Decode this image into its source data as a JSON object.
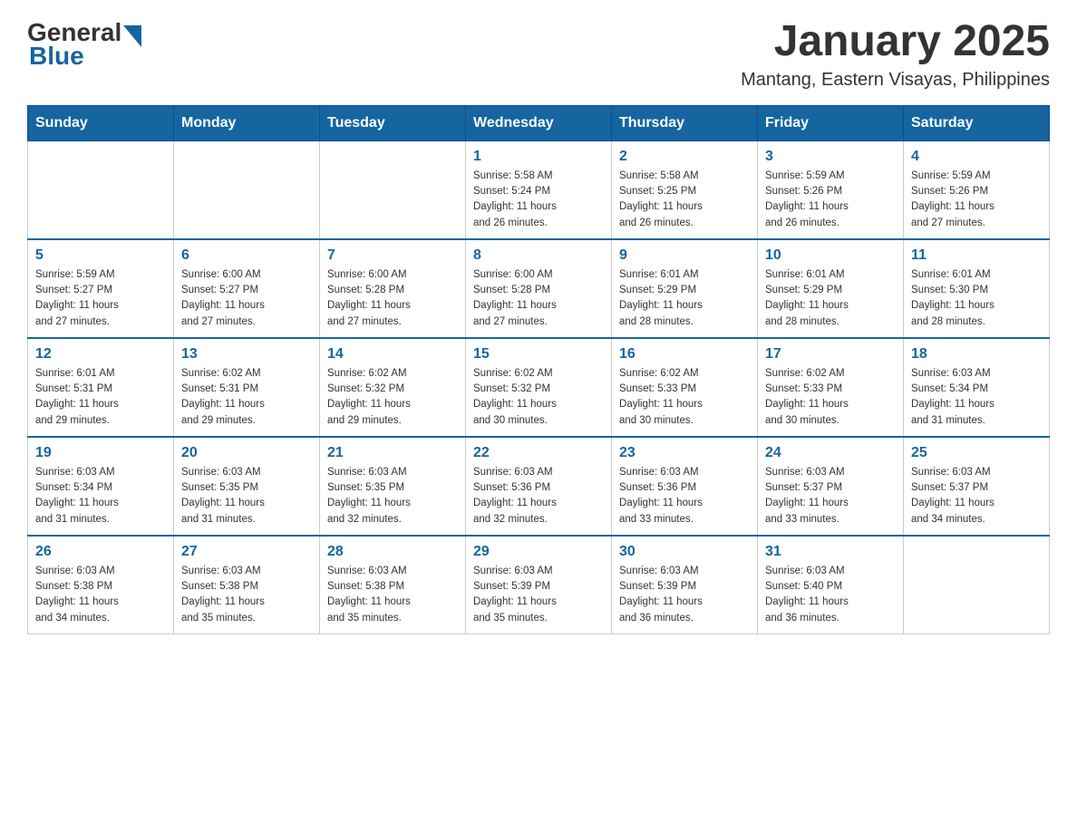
{
  "header": {
    "logo": {
      "general": "General",
      "blue": "Blue"
    },
    "title": "January 2025",
    "subtitle": "Mantang, Eastern Visayas, Philippines"
  },
  "calendar": {
    "days_of_week": [
      "Sunday",
      "Monday",
      "Tuesday",
      "Wednesday",
      "Thursday",
      "Friday",
      "Saturday"
    ],
    "weeks": [
      [
        {
          "day": "",
          "info": ""
        },
        {
          "day": "",
          "info": ""
        },
        {
          "day": "",
          "info": ""
        },
        {
          "day": "1",
          "info": "Sunrise: 5:58 AM\nSunset: 5:24 PM\nDaylight: 11 hours\nand 26 minutes."
        },
        {
          "day": "2",
          "info": "Sunrise: 5:58 AM\nSunset: 5:25 PM\nDaylight: 11 hours\nand 26 minutes."
        },
        {
          "day": "3",
          "info": "Sunrise: 5:59 AM\nSunset: 5:26 PM\nDaylight: 11 hours\nand 26 minutes."
        },
        {
          "day": "4",
          "info": "Sunrise: 5:59 AM\nSunset: 5:26 PM\nDaylight: 11 hours\nand 27 minutes."
        }
      ],
      [
        {
          "day": "5",
          "info": "Sunrise: 5:59 AM\nSunset: 5:27 PM\nDaylight: 11 hours\nand 27 minutes."
        },
        {
          "day": "6",
          "info": "Sunrise: 6:00 AM\nSunset: 5:27 PM\nDaylight: 11 hours\nand 27 minutes."
        },
        {
          "day": "7",
          "info": "Sunrise: 6:00 AM\nSunset: 5:28 PM\nDaylight: 11 hours\nand 27 minutes."
        },
        {
          "day": "8",
          "info": "Sunrise: 6:00 AM\nSunset: 5:28 PM\nDaylight: 11 hours\nand 27 minutes."
        },
        {
          "day": "9",
          "info": "Sunrise: 6:01 AM\nSunset: 5:29 PM\nDaylight: 11 hours\nand 28 minutes."
        },
        {
          "day": "10",
          "info": "Sunrise: 6:01 AM\nSunset: 5:29 PM\nDaylight: 11 hours\nand 28 minutes."
        },
        {
          "day": "11",
          "info": "Sunrise: 6:01 AM\nSunset: 5:30 PM\nDaylight: 11 hours\nand 28 minutes."
        }
      ],
      [
        {
          "day": "12",
          "info": "Sunrise: 6:01 AM\nSunset: 5:31 PM\nDaylight: 11 hours\nand 29 minutes."
        },
        {
          "day": "13",
          "info": "Sunrise: 6:02 AM\nSunset: 5:31 PM\nDaylight: 11 hours\nand 29 minutes."
        },
        {
          "day": "14",
          "info": "Sunrise: 6:02 AM\nSunset: 5:32 PM\nDaylight: 11 hours\nand 29 minutes."
        },
        {
          "day": "15",
          "info": "Sunrise: 6:02 AM\nSunset: 5:32 PM\nDaylight: 11 hours\nand 30 minutes."
        },
        {
          "day": "16",
          "info": "Sunrise: 6:02 AM\nSunset: 5:33 PM\nDaylight: 11 hours\nand 30 minutes."
        },
        {
          "day": "17",
          "info": "Sunrise: 6:02 AM\nSunset: 5:33 PM\nDaylight: 11 hours\nand 30 minutes."
        },
        {
          "day": "18",
          "info": "Sunrise: 6:03 AM\nSunset: 5:34 PM\nDaylight: 11 hours\nand 31 minutes."
        }
      ],
      [
        {
          "day": "19",
          "info": "Sunrise: 6:03 AM\nSunset: 5:34 PM\nDaylight: 11 hours\nand 31 minutes."
        },
        {
          "day": "20",
          "info": "Sunrise: 6:03 AM\nSunset: 5:35 PM\nDaylight: 11 hours\nand 31 minutes."
        },
        {
          "day": "21",
          "info": "Sunrise: 6:03 AM\nSunset: 5:35 PM\nDaylight: 11 hours\nand 32 minutes."
        },
        {
          "day": "22",
          "info": "Sunrise: 6:03 AM\nSunset: 5:36 PM\nDaylight: 11 hours\nand 32 minutes."
        },
        {
          "day": "23",
          "info": "Sunrise: 6:03 AM\nSunset: 5:36 PM\nDaylight: 11 hours\nand 33 minutes."
        },
        {
          "day": "24",
          "info": "Sunrise: 6:03 AM\nSunset: 5:37 PM\nDaylight: 11 hours\nand 33 minutes."
        },
        {
          "day": "25",
          "info": "Sunrise: 6:03 AM\nSunset: 5:37 PM\nDaylight: 11 hours\nand 34 minutes."
        }
      ],
      [
        {
          "day": "26",
          "info": "Sunrise: 6:03 AM\nSunset: 5:38 PM\nDaylight: 11 hours\nand 34 minutes."
        },
        {
          "day": "27",
          "info": "Sunrise: 6:03 AM\nSunset: 5:38 PM\nDaylight: 11 hours\nand 35 minutes."
        },
        {
          "day": "28",
          "info": "Sunrise: 6:03 AM\nSunset: 5:38 PM\nDaylight: 11 hours\nand 35 minutes."
        },
        {
          "day": "29",
          "info": "Sunrise: 6:03 AM\nSunset: 5:39 PM\nDaylight: 11 hours\nand 35 minutes."
        },
        {
          "day": "30",
          "info": "Sunrise: 6:03 AM\nSunset: 5:39 PM\nDaylight: 11 hours\nand 36 minutes."
        },
        {
          "day": "31",
          "info": "Sunrise: 6:03 AM\nSunset: 5:40 PM\nDaylight: 11 hours\nand 36 minutes."
        },
        {
          "day": "",
          "info": ""
        }
      ]
    ]
  }
}
